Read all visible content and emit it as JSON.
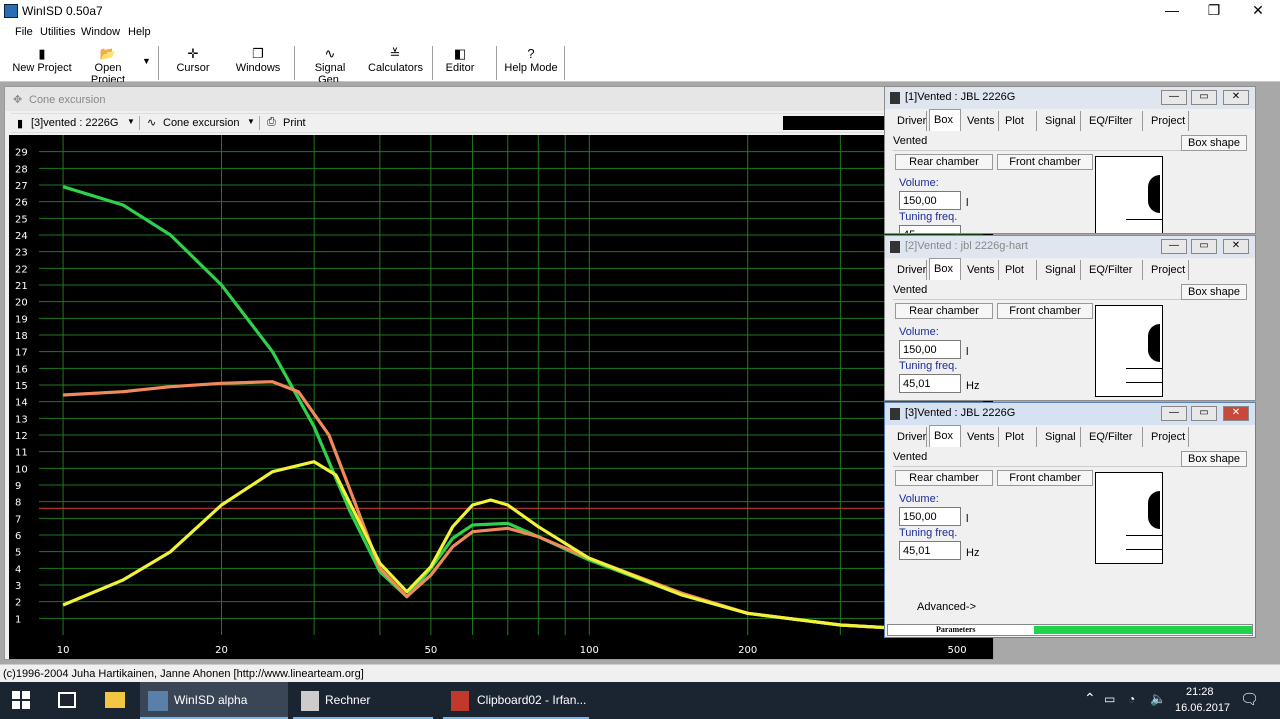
{
  "window": {
    "title": "WinISD 0.50a7",
    "minimize": "—",
    "maximize": "❐",
    "close": "✕"
  },
  "menu": [
    "File",
    "Utilities",
    "Window",
    "Help"
  ],
  "toolbar": [
    {
      "label": "New Project",
      "icon": "▮"
    },
    {
      "label": "Open Project",
      "icon": "📂"
    },
    {
      "label": "Cursor",
      "icon": "✛"
    },
    {
      "label": "Windows",
      "icon": "❐"
    },
    {
      "label": "Signal Gen.",
      "icon": "∿"
    },
    {
      "label": "Calculators",
      "icon": "≚"
    },
    {
      "label": "Editor",
      "icon": "◧"
    },
    {
      "label": "Help Mode",
      "icon": "?"
    }
  ],
  "plot_window": {
    "caption": "Cone excursion",
    "project_select": "[3]vented : 2226G",
    "plot_select": "Cone excursion",
    "print_label": "Print"
  },
  "chart_data": {
    "type": "line",
    "x_scale": "log",
    "xlim": [
      9,
      560
    ],
    "ylim": [
      0,
      30
    ],
    "x_ticks": [
      "10",
      "20",
      "50",
      "100",
      "200",
      "500"
    ],
    "y_ticks": [
      "1",
      "2",
      "3",
      "4",
      "5",
      "6",
      "7",
      "8",
      "9",
      "10",
      "11",
      "12",
      "13",
      "14",
      "15",
      "16",
      "17",
      "18",
      "19",
      "20",
      "21",
      "22",
      "23",
      "24",
      "25",
      "26",
      "27",
      "28",
      "29"
    ],
    "grid": true,
    "reference_line": {
      "y": 7.6,
      "color": "#c0392b"
    },
    "series": [
      {
        "color": "#2fd14b",
        "x": [
          10,
          13,
          16,
          20,
          25,
          30,
          35,
          40,
          45,
          50,
          55,
          60,
          70,
          80,
          100,
          150,
          200,
          300,
          500
        ],
        "y": [
          26.9,
          25.8,
          24,
          21,
          17,
          12.5,
          7.5,
          3.8,
          2.3,
          4,
          5.8,
          6.6,
          6.7,
          5.9,
          4.5,
          2.4,
          1.3,
          0.6,
          0.2
        ]
      },
      {
        "color": "#f08a5d",
        "x": [
          10,
          13,
          16,
          20,
          25,
          28,
          32,
          36,
          40,
          45,
          50,
          55,
          60,
          70,
          80,
          100,
          150,
          200,
          300,
          500
        ],
        "y": [
          14.4,
          14.6,
          14.9,
          15.1,
          15.2,
          14.6,
          12,
          7.8,
          4,
          2.3,
          3.6,
          5.3,
          6.2,
          6.4,
          5.9,
          4.6,
          2.5,
          1.3,
          0.6,
          0.2
        ]
      },
      {
        "color": "#f2f23a",
        "x": [
          10,
          13,
          16,
          20,
          25,
          30,
          33,
          36,
          40,
          45,
          50,
          55,
          60,
          65,
          70,
          80,
          100,
          150,
          200,
          300,
          500
        ],
        "y": [
          1.8,
          3.3,
          5,
          7.8,
          9.8,
          10.4,
          9.6,
          7.2,
          4.3,
          2.6,
          4.1,
          6.5,
          7.8,
          8.1,
          7.8,
          6.5,
          4.6,
          2.4,
          1.3,
          0.6,
          0.2
        ]
      }
    ]
  },
  "project_windows": [
    {
      "title": "[1]Vented : JBL 2226G",
      "tabs": [
        "Driver",
        "Box",
        "Vents",
        "Plot",
        "Signal",
        "EQ/Filter",
        "Project"
      ],
      "type": "Vented",
      "box_shape": "Box shape",
      "rear": "Rear chamber",
      "front": "Front chamber",
      "volume_label": "Volume:",
      "volume": "150,00",
      "volume_unit": "l",
      "tuning_label": "Tuning freq.",
      "tuning": "45"
    },
    {
      "title": "[2]Vented : jbl 2226g-hart",
      "tabs": [
        "Driver",
        "Box",
        "Vents",
        "Plot",
        "Signal",
        "EQ/Filter",
        "Project"
      ],
      "type": "Vented",
      "box_shape": "Box shape",
      "rear": "Rear chamber",
      "front": "Front chamber",
      "volume_label": "Volume:",
      "volume": "150,00",
      "volume_unit": "l",
      "tuning_label": "Tuning freq.",
      "tuning": "45,01",
      "tuning_unit": "Hz"
    },
    {
      "title": "[3]Vented : JBL 2226G",
      "tabs": [
        "Driver",
        "Box",
        "Vents",
        "Plot",
        "Signal",
        "EQ/Filter",
        "Project"
      ],
      "type": "Vented",
      "box_shape": "Box shape",
      "rear": "Rear chamber",
      "front": "Front chamber",
      "volume_label": "Volume:",
      "volume": "150,00",
      "volume_unit": "l",
      "tuning_label": "Tuning freq.",
      "tuning": "45,01",
      "tuning_unit": "Hz",
      "advanced": "Advanced->",
      "parameters": "Parameters"
    }
  ],
  "statusbar": {
    "text": "(c)1996-2004 Juha Hartikainen, Janne Ahonen [http://www.linearteam.org]"
  },
  "taskbar": {
    "apps": [
      "WinISD alpha",
      "Rechner",
      "Clipboard02 - Irfan..."
    ],
    "time": "21:28",
    "date": "16.06.2017"
  }
}
